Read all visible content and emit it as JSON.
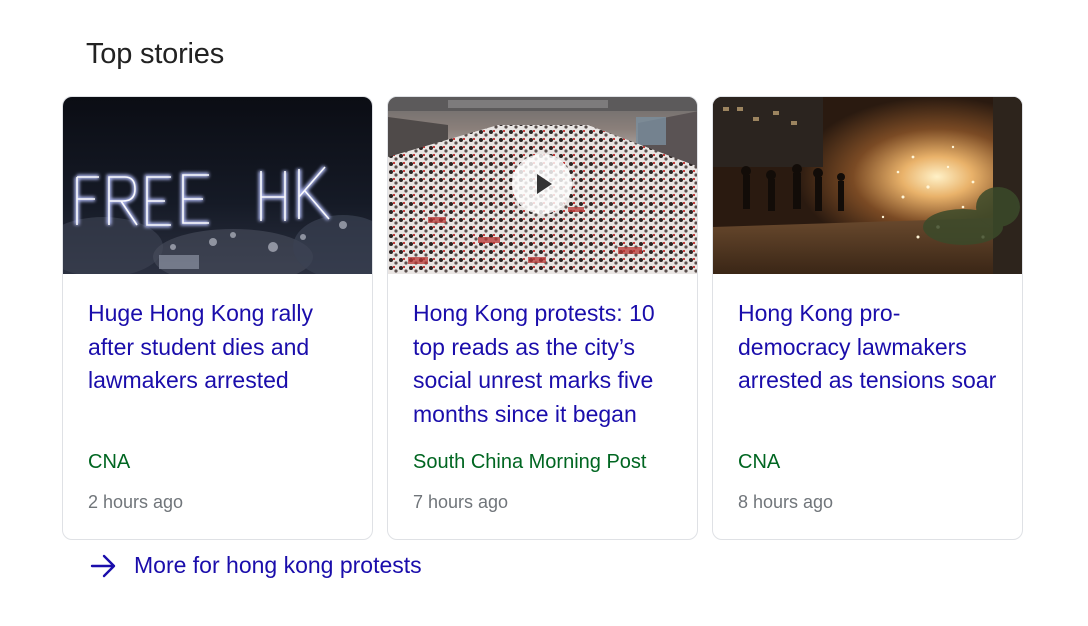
{
  "section": {
    "title": "Top stories"
  },
  "stories": [
    {
      "headline": "Huge Hong Kong rally after student dies and lawmakers arrested",
      "source": "CNA",
      "time": "2 hours ago",
      "thumbnail": "free-hk-neon-sign-photo",
      "has_video": false
    },
    {
      "headline": "Hong Kong protests: 10 top reads as the city’s social unrest marks five months since it began",
      "source": "South China Morning Post",
      "time": "7 hours ago",
      "thumbnail": "crowd-march-photo",
      "has_video": true
    },
    {
      "headline": "Hong Kong pro-democracy lawmakers arrested as tensions soar",
      "source": "CNA",
      "time": "8 hours ago",
      "thumbnail": "street-sparks-photo",
      "has_video": false
    }
  ],
  "more": {
    "label": "More for hong kong protests",
    "icon": "arrow-right-icon"
  },
  "colors": {
    "link": "#1a0dab",
    "source": "#006621",
    "meta": "#70757a",
    "border": "#dfe1e5"
  }
}
